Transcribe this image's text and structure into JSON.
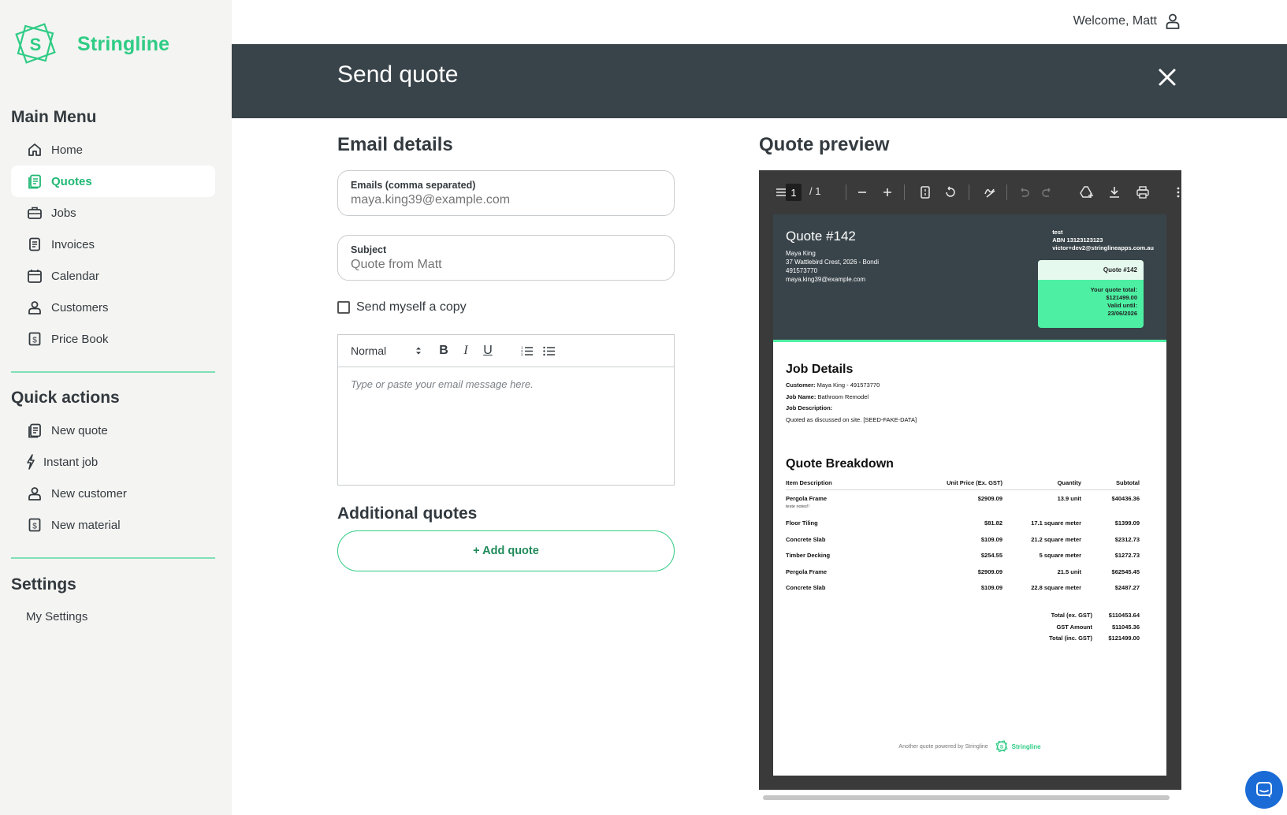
{
  "app": {
    "name": "Stringline",
    "brand_color": "#2fcc85"
  },
  "topbar": {
    "welcome": "Welcome, Matt",
    "icon": "user-icon"
  },
  "sidebar": {
    "main_menu_title": "Main Menu",
    "main_menu": [
      {
        "label": "Home",
        "icon": "home-icon"
      },
      {
        "label": "Quotes",
        "icon": "quote-icon",
        "active": true
      },
      {
        "label": "Jobs",
        "icon": "briefcase-icon"
      },
      {
        "label": "Invoices",
        "icon": "invoice-icon"
      },
      {
        "label": "Calendar",
        "icon": "calendar-icon"
      },
      {
        "label": "Customers",
        "icon": "user-icon"
      },
      {
        "label": "Price Book",
        "icon": "dollar-icon"
      }
    ],
    "quick_actions_title": "Quick actions",
    "quick_actions": [
      {
        "label": "New quote",
        "icon": "quote-icon"
      },
      {
        "label": "Instant job",
        "icon": "lightning-icon"
      },
      {
        "label": "New customer",
        "icon": "user-icon"
      },
      {
        "label": "New material",
        "icon": "dollar-icon"
      }
    ],
    "settings_title": "Settings",
    "settings": [
      {
        "label": "My Settings"
      }
    ]
  },
  "modal": {
    "title": "Send quote",
    "email_details_title": "Email details",
    "emails_label": "Emails (comma separated)",
    "emails_placeholder": "maya.king39@example.com",
    "subject_label": "Subject",
    "subject_placeholder": "Quote from Matt",
    "copy_label": "Send myself a copy",
    "editor": {
      "format": "Normal",
      "bold": "B",
      "italic": "I",
      "underline": "U",
      "placeholder": "Type or paste your email message here."
    },
    "additional_title": "Additional quotes",
    "add_quote_label": "+ Add quote",
    "preview_title": "Quote preview"
  },
  "pdf": {
    "page_current": "1",
    "page_total": "/ 1",
    "quote": {
      "title": "Quote #142",
      "client": [
        "Maya King",
        "37 Wattlebird Crest, 2026 - Bondi",
        "491573770",
        "maya.king39@example.com"
      ],
      "company": [
        "test",
        "ABN 13123123123",
        "victor+dev2@stringlineapps.com.au"
      ],
      "card_title": "Quote #142",
      "card_lines": [
        "Your quote total:",
        "$121499.00",
        "Valid until:",
        "23/06/2026"
      ],
      "job_details_title": "Job Details",
      "customer_label": "Customer:",
      "customer_value": "Maya King - 491573770",
      "job_name_label": "Job Name:",
      "job_name_value": "Bathroom Remodel",
      "job_desc_label": "Job Description:",
      "job_desc_value": "Quoted as discussed on site. [SEED-FAKE-DATA]",
      "breakdown_title": "Quote Breakdown",
      "columns": [
        "Item Description",
        "Unit Price (Ex. GST)",
        "Quantity",
        "Subtotal"
      ],
      "items": [
        {
          "desc": "Pergola Frame",
          "price": "$2909.09",
          "qty": "13.9 unit",
          "subtotal": "$40436.36",
          "note": "teste notes!!"
        },
        {
          "desc": "Floor Tiling",
          "price": "$81.82",
          "qty": "17.1 square meter",
          "subtotal": "$1399.09"
        },
        {
          "desc": "Concrete Slab",
          "price": "$109.09",
          "qty": "21.2 square meter",
          "subtotal": "$2312.73"
        },
        {
          "desc": "Timber Decking",
          "price": "$254.55",
          "qty": "5 square meter",
          "subtotal": "$1272.73"
        },
        {
          "desc": "Pergola Frame",
          "price": "$2909.09",
          "qty": "21.5 unit",
          "subtotal": "$62545.45"
        },
        {
          "desc": "Concrete Slab",
          "price": "$109.09",
          "qty": "22.8 square meter",
          "subtotal": "$2487.27"
        }
      ],
      "totals": [
        {
          "label": "Total (ex. GST)",
          "value": "$110453.64"
        },
        {
          "label": "GST Amount",
          "value": "$11045.36"
        },
        {
          "label": "Total (inc. GST)",
          "value": "$121499.00"
        }
      ],
      "footer_text": "Another quote powered by Stringline",
      "footer_logo": "Stringline"
    }
  }
}
